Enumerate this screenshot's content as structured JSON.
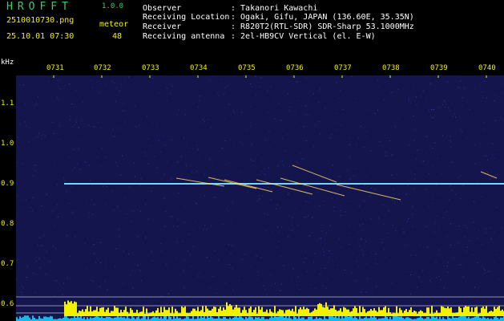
{
  "app": {
    "title": "HROFFT",
    "version": "1.0.0"
  },
  "file": {
    "name": "2510010730.png",
    "datetime": "25.10.01 07:30"
  },
  "meteor": {
    "label": "meteor",
    "count": "48"
  },
  "info": [
    {
      "label": "Observer",
      "value": ": Takanori Kawachi"
    },
    {
      "label": "Receiving Location",
      "value": ": Ogaki, Gifu, JAPAN (136.60E, 35.35N)"
    },
    {
      "label": "Receiver",
      "value": ": R820T2(RTL-SDR) SDR-Sharp 53.1000MHz"
    },
    {
      "label": "Receiving antenna",
      "value": ": 2el-HB9CV Vertical (el. E-W)"
    }
  ],
  "axis": {
    "unit": "kHz",
    "time_labels": [
      "0731",
      "0732",
      "0733",
      "0734",
      "0735",
      "0736",
      "0737",
      "0738",
      "0739",
      "0740"
    ],
    "freq_labels": [
      "1.1",
      "1.0",
      "0.9",
      "0.8",
      "0.7",
      "0.6"
    ]
  },
  "colors": {
    "background": "#15154d",
    "text_yellow": "#f2f200",
    "title_green": "#35d35a",
    "carrier": "#6fd8ff",
    "meteor_trail": "#ffe066",
    "level_bar": "#f2f200",
    "noise_floor": "#19b8e8"
  }
}
